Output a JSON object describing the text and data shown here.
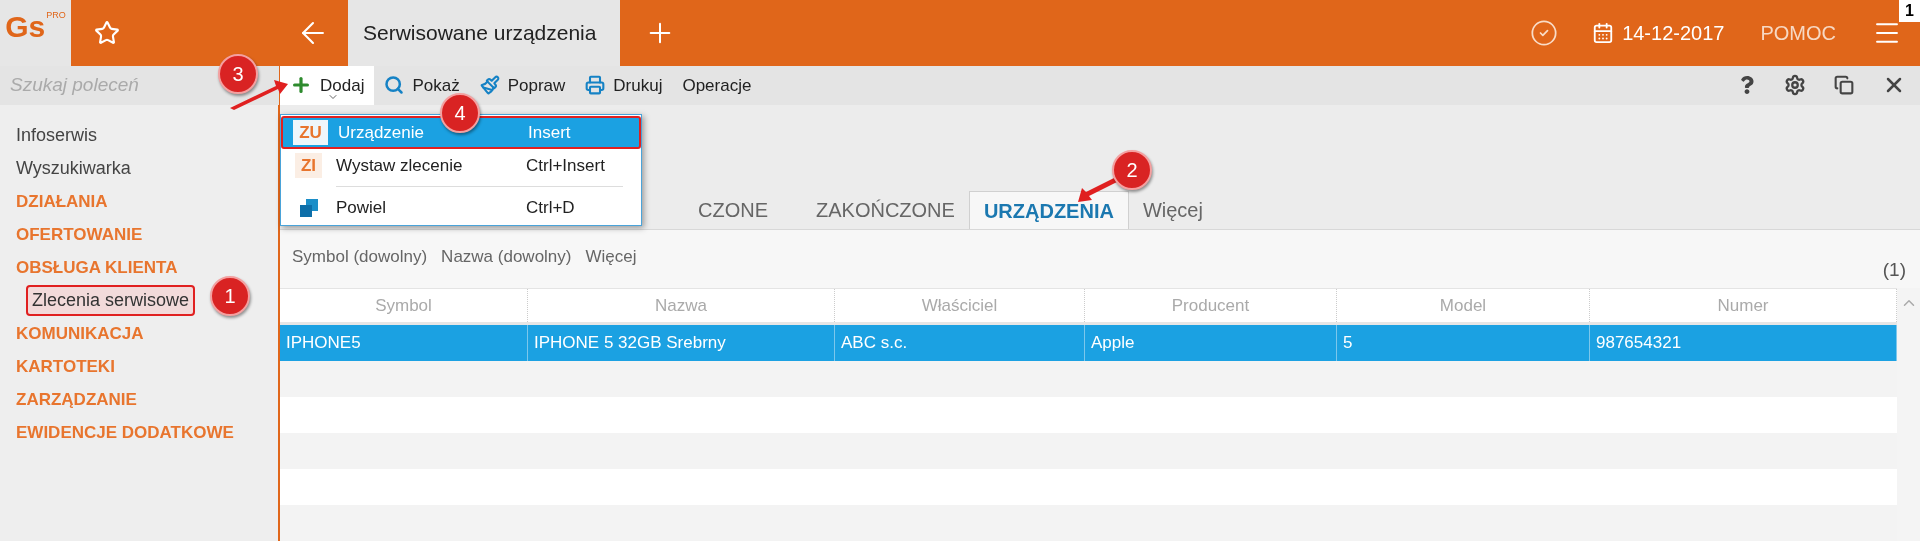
{
  "logo": {
    "text": "Gs",
    "sup": "PRO"
  },
  "top_bar": {
    "tab_title": "Serwisowane urządzenia",
    "date": "14-12-2017",
    "help": "POMOC",
    "badge": "1"
  },
  "search": {
    "placeholder": "Szukaj poleceń"
  },
  "toolbar": [
    {
      "label": "Dodaj",
      "kind": "add",
      "open": true
    },
    {
      "label": "Pokaż",
      "kind": "show",
      "open": false
    },
    {
      "label": "Popraw",
      "kind": "edit",
      "open": false
    },
    {
      "label": "Drukuj",
      "kind": "print",
      "open": false
    },
    {
      "label": "Operacje",
      "kind": "text",
      "open": false
    }
  ],
  "sidebar": {
    "items": [
      {
        "label": "Infoserwis",
        "kind": "link",
        "highlighted": false
      },
      {
        "label": "Wyszukiwarka",
        "kind": "link",
        "highlighted": false
      },
      {
        "label": "DZIAŁANIA",
        "kind": "section",
        "highlighted": false
      },
      {
        "label": "OFERTOWANIE",
        "kind": "section",
        "highlighted": false
      },
      {
        "label": "OBSŁUGA KLIENTA",
        "kind": "section",
        "highlighted": false
      },
      {
        "label": "Zlecenia serwisowe",
        "kind": "sub",
        "highlighted": true
      },
      {
        "label": "KOMUNIKACJA",
        "kind": "section",
        "highlighted": false
      },
      {
        "label": "KARTOTEKI",
        "kind": "section",
        "highlighted": false
      },
      {
        "label": "ZARZĄDZANIE",
        "kind": "section",
        "highlighted": false
      },
      {
        "label": "EWIDENCJE DODATKOWE",
        "kind": "section",
        "highlighted": false
      }
    ]
  },
  "menu": {
    "items": [
      {
        "code": "ZU",
        "label": "Urządzenie",
        "shortcut": "Insert",
        "kind": "code",
        "selected": true
      },
      {
        "code": "ZI",
        "label": "Wystaw zlecenie",
        "shortcut": "Ctrl+Insert",
        "kind": "code",
        "selected": false
      },
      {
        "label": "Powiel",
        "shortcut": "Ctrl+D",
        "kind": "copy",
        "selected": false
      }
    ]
  },
  "tabs": [
    {
      "label": "CZONE",
      "selected": false
    },
    {
      "label": "ZAKOŃCZONE",
      "selected": false
    },
    {
      "label": "URZĄDZENIA",
      "selected": true
    },
    {
      "label": "Więcej",
      "selected": false
    }
  ],
  "filters": [
    "Symbol (dowolny)",
    "Nazwa (dowolny)",
    "Więcej"
  ],
  "count": "(1)",
  "table": {
    "columns": [
      "Symbol",
      "Nazwa",
      "Właściciel",
      "Producent",
      "Model",
      "Numer"
    ],
    "rows": [
      {
        "cells": [
          "IPHONE5",
          "IPHONE 5 32GB Srebrny",
          "ABC s.c.",
          "Apple",
          "5",
          "987654321"
        ],
        "selected": true
      }
    ]
  },
  "annotations": [
    {
      "label": "1"
    },
    {
      "label": "2"
    },
    {
      "label": "3"
    },
    {
      "label": "4"
    }
  ]
}
